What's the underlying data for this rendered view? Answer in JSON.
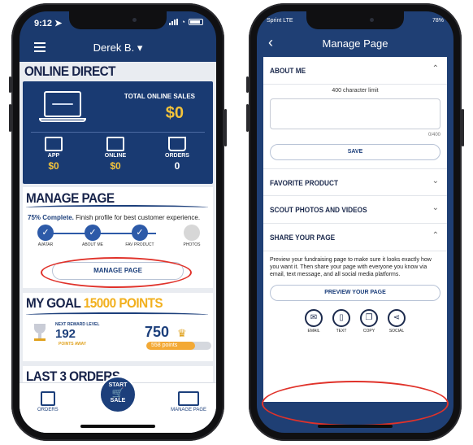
{
  "left_phone": {
    "status": {
      "time": "9:12 ➤"
    },
    "header": {
      "user_name": "Derek B. ▾"
    },
    "online_direct": {
      "title": "ONLINE DIRECT",
      "total_label": "TOTAL ONLINE SALES",
      "total_value": "$0",
      "stats": [
        {
          "label": "APP",
          "value": "$0"
        },
        {
          "label": "ONLINE",
          "value": "$0"
        },
        {
          "label": "ORDERS",
          "value": "0"
        }
      ]
    },
    "manage_page": {
      "title": "MANAGE PAGE",
      "complete_bold": "75% Complete.",
      "complete_text": " Finish profile for best customer experience.",
      "steps": [
        "AVATAR",
        "ABOUT ME",
        "FAV PRODUCT",
        "PHOTOS"
      ],
      "button_label": "MANAGE PAGE"
    },
    "goal": {
      "title_prefix": "MY GOAL ",
      "title_points": "15000 POINTS",
      "next_reward_label": "NEXT REWARD LEVEL",
      "next_reward_value": "192",
      "points_away": "POINTS AWAY",
      "points_big": "750",
      "progress_text": "558 points",
      "progress_fraction": 0.75
    },
    "last_orders_title": "LAST 3 ORDERS",
    "start_button": {
      "line1": "START",
      "line2": "SALE"
    },
    "tabs": {
      "orders": "ORDERS",
      "manage": "MANAGE PAGE"
    }
  },
  "right_phone": {
    "status": {
      "carrier": "Sprint LTE",
      "battery": "78%"
    },
    "header": {
      "title": "Manage Page"
    },
    "about_me": {
      "title": "ABOUT ME",
      "char_limit": "400 character limit",
      "counter": "0/400",
      "save_label": "SAVE"
    },
    "favorite_product": "FAVORITE PRODUCT",
    "scout_photos": "SCOUT PHOTOS AND VIDEOS",
    "share": {
      "title": "SHARE YOUR PAGE",
      "text": "Preview your fundraising page to make sure it looks exactly how you want it. Then share your page with everyone you know via email, text message, and all social media platforms.",
      "preview_label": "PREVIEW YOUR PAGE",
      "options": [
        "EMAIL",
        "TEXT",
        "COPY",
        "SOCIAL"
      ]
    }
  },
  "colors": {
    "navy": "#1b3a6e",
    "gold": "#f3c33b",
    "highlight_ring": "#e0322a"
  }
}
